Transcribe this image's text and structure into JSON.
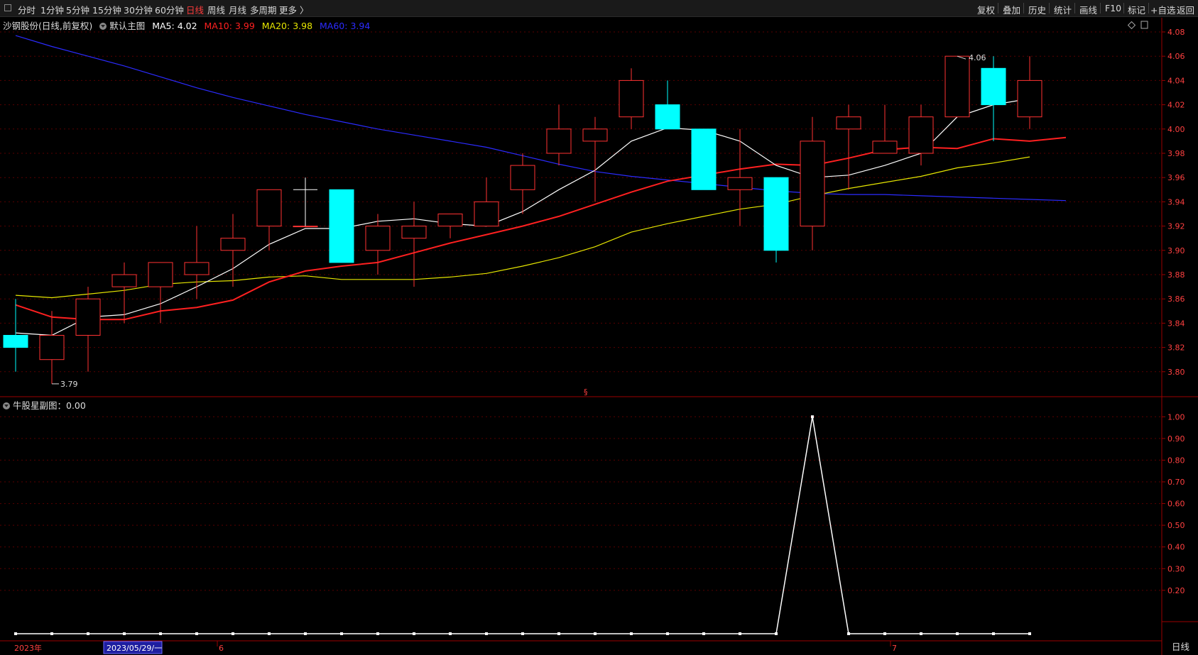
{
  "toolbar": {
    "periods": [
      "分时",
      "1分钟",
      "5分钟",
      "15分钟",
      "30分钟",
      "60分钟",
      "日线",
      "周线",
      "月线",
      "多周期",
      "更多 〉"
    ],
    "active_period": "日线",
    "right_buttons": [
      "复权",
      "叠加",
      "历史",
      "统计",
      "画线",
      "F10",
      "标记",
      "+自选",
      "返回"
    ]
  },
  "main_panel": {
    "stock_title": "沙钢股份(日线,前复权)",
    "template_label": "默认主图",
    "ma_labels": [
      {
        "text": "MA5: 4.02",
        "color": "#ffffff"
      },
      {
        "text": "MA10: 3.99",
        "color": "#ff2020"
      },
      {
        "text": "MA20: 3.98",
        "color": "#e6e600"
      },
      {
        "text": "MA60: 3.94",
        "color": "#2b2bff"
      }
    ],
    "low_marker": "3.79",
    "high_marker": "4.06",
    "center_marker": "§"
  },
  "sub_panel": {
    "title": "牛股星副图：0.00"
  },
  "time_axis": {
    "year_label": "2023年",
    "cursor_date": "2023/05/29/一",
    "month_labels": [
      "6",
      "7"
    ]
  },
  "sidebar_tab": "日线",
  "colors": {
    "up": "#ff3232",
    "down": "#00ffff",
    "ma5": "#ffffff",
    "ma10": "#ff2020",
    "ma20": "#e6e600",
    "ma60": "#2b2bff",
    "grid": "#5a0000",
    "axis": "#9b0000",
    "tick": "#ff4040"
  },
  "chart_data": [
    {
      "type": "candlestick",
      "ylim": [
        3.78,
        4.08
      ],
      "yticks": [
        "4.08",
        "4.06",
        "4.04",
        "4.02",
        "4.00",
        "3.98",
        "3.96",
        "3.94",
        "3.92",
        "3.90",
        "3.88",
        "3.86",
        "3.84",
        "3.82",
        "3.80"
      ],
      "candles": [
        {
          "o": 3.83,
          "h": 3.86,
          "l": 3.8,
          "c": 3.82
        },
        {
          "o": 3.81,
          "h": 3.85,
          "l": 3.79,
          "c": 3.83
        },
        {
          "o": 3.83,
          "h": 3.87,
          "l": 3.8,
          "c": 3.86
        },
        {
          "o": 3.87,
          "h": 3.89,
          "l": 3.84,
          "c": 3.88
        },
        {
          "o": 3.87,
          "h": 3.89,
          "l": 3.84,
          "c": 3.89
        },
        {
          "o": 3.88,
          "h": 3.92,
          "l": 3.86,
          "c": 3.89
        },
        {
          "o": 3.9,
          "h": 3.93,
          "l": 3.87,
          "c": 3.91
        },
        {
          "o": 3.92,
          "h": 3.95,
          "l": 3.9,
          "c": 3.95
        },
        {
          "o": 3.92,
          "h": 3.96,
          "l": 3.92,
          "c": 3.92
        },
        {
          "o": 3.95,
          "h": 3.95,
          "l": 3.89,
          "c": 3.89
        },
        {
          "o": 3.9,
          "h": 3.93,
          "l": 3.88,
          "c": 3.92
        },
        {
          "o": 3.91,
          "h": 3.94,
          "l": 3.87,
          "c": 3.92
        },
        {
          "o": 3.92,
          "h": 3.93,
          "l": 3.91,
          "c": 3.93
        },
        {
          "o": 3.92,
          "h": 3.96,
          "l": 3.92,
          "c": 3.94
        },
        {
          "o": 3.95,
          "h": 3.98,
          "l": 3.93,
          "c": 3.97
        },
        {
          "o": 3.98,
          "h": 4.02,
          "l": 3.97,
          "c": 4.0
        },
        {
          "o": 3.99,
          "h": 4.01,
          "l": 3.94,
          "c": 4.0
        },
        {
          "o": 4.01,
          "h": 4.05,
          "l": 4.0,
          "c": 4.04
        },
        {
          "o": 4.02,
          "h": 4.04,
          "l": 4.0,
          "c": 4.0
        },
        {
          "o": 4.0,
          "h": 4.0,
          "l": 3.95,
          "c": 3.95
        },
        {
          "o": 3.95,
          "h": 4.0,
          "l": 3.92,
          "c": 3.96
        },
        {
          "o": 3.96,
          "h": 3.96,
          "l": 3.89,
          "c": 3.9
        },
        {
          "o": 3.92,
          "h": 4.01,
          "l": 3.9,
          "c": 3.99
        },
        {
          "o": 4.0,
          "h": 4.02,
          "l": 3.95,
          "c": 4.01
        },
        {
          "o": 3.98,
          "h": 4.02,
          "l": 3.98,
          "c": 3.99
        },
        {
          "o": 3.98,
          "h": 4.02,
          "l": 3.97,
          "c": 4.01
        },
        {
          "o": 4.01,
          "h": 4.06,
          "l": 4.01,
          "c": 4.06
        },
        {
          "o": 4.05,
          "h": 4.06,
          "l": 3.99,
          "c": 4.02
        },
        {
          "o": 4.01,
          "h": 4.06,
          "l": 4.0,
          "c": 4.04
        }
      ],
      "ma5": [
        3.832,
        3.83,
        3.845,
        3.847,
        3.856,
        3.87,
        3.885,
        3.905,
        3.918,
        3.918,
        3.924,
        3.926,
        3.922,
        3.92,
        3.932,
        3.95,
        3.966,
        3.99,
        4.001,
        3.999,
        3.99,
        3.97,
        3.96,
        3.962,
        3.97,
        3.98,
        4.01,
        4.02,
        4.025
      ],
      "ma10": [
        3.855,
        3.845,
        3.843,
        3.843,
        3.85,
        3.853,
        3.859,
        3.874,
        3.883,
        3.887,
        3.89,
        3.898,
        3.906,
        3.913,
        3.92,
        3.928,
        3.938,
        3.948,
        3.957,
        3.962,
        3.967,
        3.971,
        3.97,
        3.976,
        3.983,
        3.985,
        3.984,
        3.992,
        3.99,
        3.993
      ],
      "ma20": [
        3.863,
        3.861,
        3.864,
        3.867,
        3.872,
        3.874,
        3.875,
        3.878,
        3.879,
        3.876,
        3.876,
        3.876,
        3.878,
        3.881,
        3.887,
        3.894,
        3.903,
        3.915,
        3.922,
        3.928,
        3.934,
        3.938,
        3.945,
        3.951,
        3.956,
        3.961,
        3.968,
        3.972,
        3.977
      ],
      "ma60": [
        4.077,
        4.068,
        4.06,
        4.052,
        4.043,
        4.034,
        4.026,
        4.019,
        4.012,
        4.006,
        4.0,
        3.995,
        3.99,
        3.985,
        3.978,
        3.971,
        3.965,
        3.961,
        3.958,
        3.955,
        3.952,
        3.949,
        3.947,
        3.946,
        3.946,
        3.945,
        3.944,
        3.943,
        3.942,
        3.941
      ]
    },
    {
      "type": "line",
      "title": "牛股星副图：0.00",
      "ylim": [
        0.0,
        1.05
      ],
      "yticks": [
        "1.00",
        "0.90",
        "0.80",
        "0.70",
        "0.60",
        "0.50",
        "0.40",
        "0.30",
        "0.20"
      ],
      "values": [
        0,
        0,
        0,
        0,
        0,
        0,
        0,
        0,
        0,
        0,
        0,
        0,
        0,
        0,
        0,
        0,
        0,
        0,
        0,
        0,
        0,
        0,
        1.0,
        0,
        0,
        0,
        0,
        0,
        0
      ]
    }
  ]
}
